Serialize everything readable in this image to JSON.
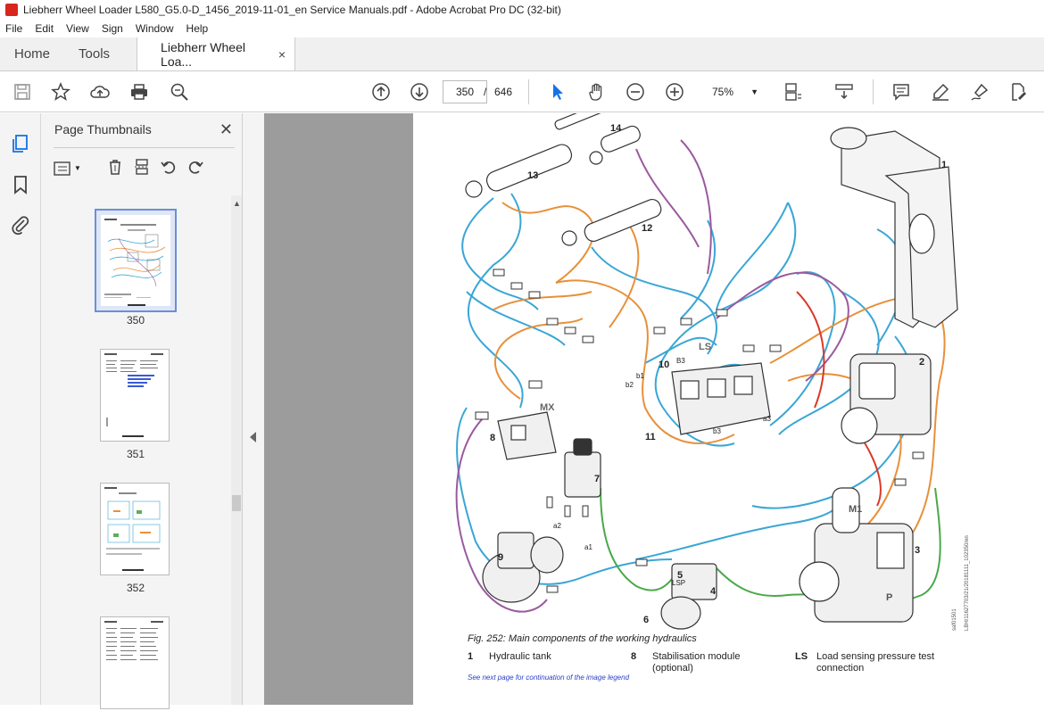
{
  "window": {
    "title": "Liebherr Wheel Loader L580_G5.0-D_1456_2019-11-01_en Service Manuals.pdf - Adobe Acrobat Pro DC (32-bit)"
  },
  "menu": [
    "File",
    "Edit",
    "View",
    "Sign",
    "Window",
    "Help"
  ],
  "tabs": {
    "home": "Home",
    "tools": "Tools",
    "document": "Liebherr Wheel Loa...",
    "close": "×"
  },
  "toolbar": {
    "current_page": "350",
    "page_separator": "/",
    "total_pages": "646",
    "zoom": "75%"
  },
  "panel": {
    "title": "Page Thumbnails",
    "close": "✕",
    "thumbnails": [
      {
        "label": "350",
        "selected": true
      },
      {
        "label": "351",
        "selected": false
      },
      {
        "label": "352",
        "selected": false
      },
      {
        "label": "",
        "selected": false
      }
    ]
  },
  "document": {
    "diagram_labels": [
      "1",
      "2",
      "3",
      "4",
      "5",
      "6",
      "7",
      "8",
      "9",
      "10",
      "11",
      "12",
      "13",
      "14",
      "MX",
      "LS",
      "M1",
      "P",
      "b1",
      "b2",
      "a1",
      "a2",
      "a3",
      "B3",
      "b3",
      "LSP"
    ],
    "caption": "Fig. 252: Main components of the working hydraulics",
    "legend": [
      {
        "num": "1",
        "text": "Hydraulic tank"
      },
      {
        "num": "8",
        "text": "Stabilisation module (optional)"
      },
      {
        "num": "LS",
        "text": "Load sensing pressure test connection"
      }
    ],
    "continuation_note": "See next page for continuation of the image legend",
    "side_code_1": "saf01501",
    "side_code_2": "LBH/11627703/21/20181111_102350/en"
  },
  "colors": {
    "blue_line": "#3aa6d6",
    "orange_line": "#e8903a",
    "purple_line": "#9a5a9e",
    "green_line": "#4aa84a",
    "red_line": "#d83a2a",
    "viewer_bg": "#9c9c9c",
    "accent": "#1473e6"
  }
}
